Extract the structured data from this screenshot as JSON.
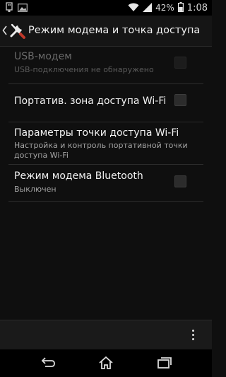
{
  "status_bar": {
    "battery_percent": "42%",
    "time": "1:08",
    "icons": [
      "usb-icon",
      "image-icon",
      "wifi-icon",
      "signal-icon",
      "battery-icon"
    ]
  },
  "action_bar": {
    "title": "Режим модема и точка доступа",
    "icon": "tools-icon"
  },
  "settings": {
    "items": [
      {
        "title": "USB-модем",
        "summary": "USB-подключения не обнаружено",
        "enabled": false,
        "checked": false
      },
      {
        "title": "Портатив. зона доступа Wi-Fi",
        "summary": "",
        "enabled": true,
        "checked": false
      },
      {
        "title": "Параметры точки доступа Wi-Fi",
        "summary": "Настройка и контроль портативной точки доступа Wi-Fi",
        "enabled": true
      },
      {
        "title": "Режим модема Bluetooth",
        "summary": "Выключен",
        "enabled": true,
        "checked": false
      }
    ]
  },
  "colors": {
    "background": "#0f0f0f",
    "accent": "#ffffff"
  }
}
